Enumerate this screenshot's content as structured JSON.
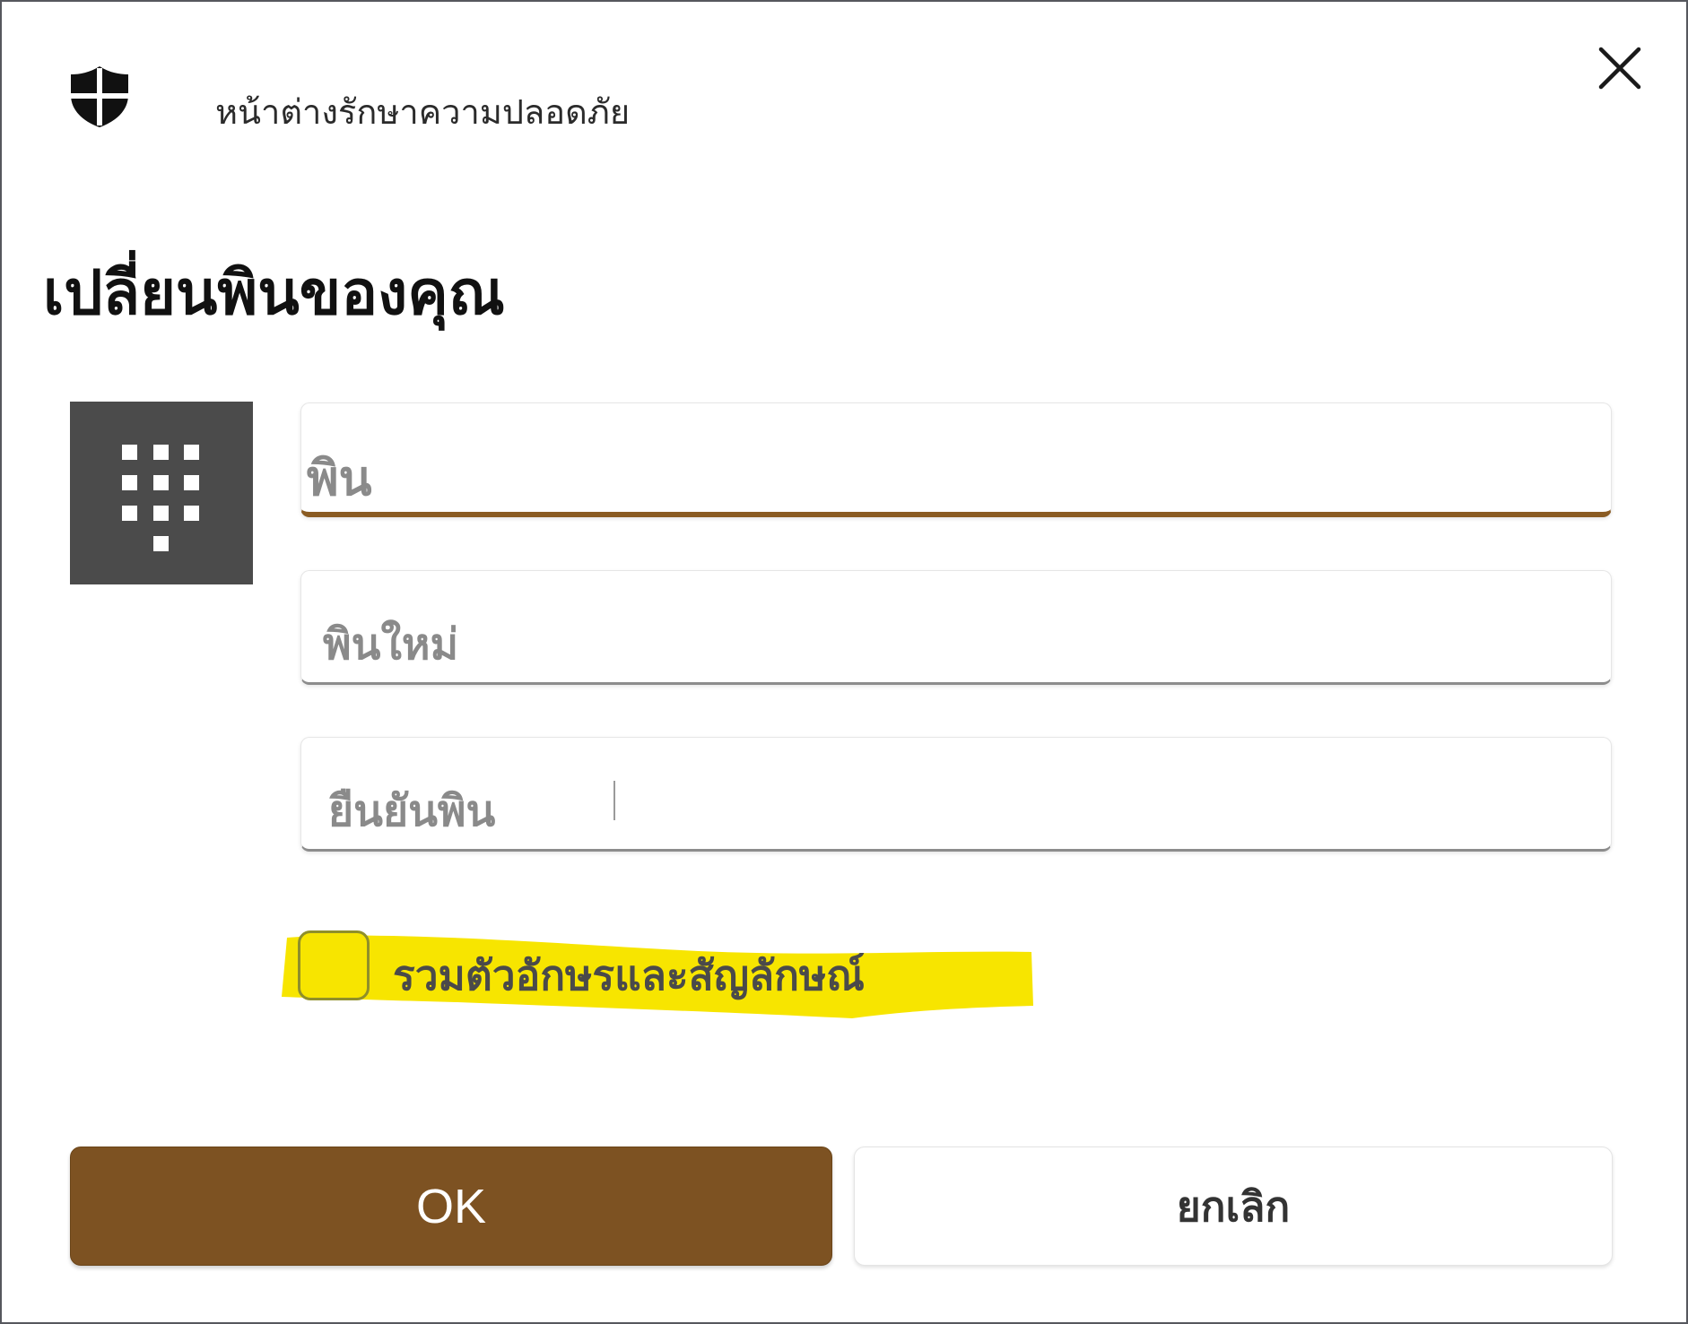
{
  "window": {
    "title": "หน้าต่างรักษาความปลอดภัย",
    "shield_icon": "shield-icon",
    "close_icon": "close-icon"
  },
  "dialog": {
    "heading": "เปลี่ยนพินของคุณ",
    "keypad_icon": "keypad-icon",
    "fields": {
      "current_pin": {
        "placeholder": "พิน",
        "value": "",
        "focused": true
      },
      "new_pin": {
        "placeholder": "พินใหม่",
        "value": ""
      },
      "confirm_pin": {
        "placeholder": "ยืนยันพิน",
        "value": ""
      }
    },
    "include_chars_checkbox": {
      "label": "รวมตัวอักษรและสัญลักษณ์",
      "checked": false
    },
    "buttons": {
      "ok": "OK",
      "cancel": "ยกเลิก"
    }
  },
  "colors": {
    "accent": "#7d5222",
    "focus_underline": "#8a5b22",
    "keypad_tile": "#4b4b4b",
    "highlight": "#f7e500",
    "border": "#56585e"
  }
}
